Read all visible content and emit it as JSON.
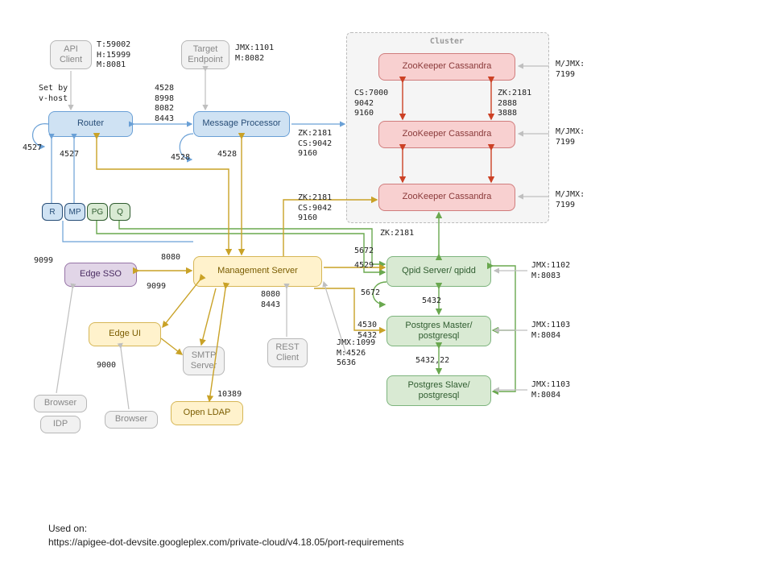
{
  "cluster_title": "Cluster",
  "nodes": {
    "api_client": "API\nClient",
    "target_ep": "Target\nEndpoint",
    "router": "Router",
    "msgproc": "Message Processor",
    "zk1": "ZooKeeper\nCassandra",
    "zk2": "ZooKeeper\nCassandra",
    "zk3": "ZooKeeper\nCassandra",
    "chip_r": "R",
    "chip_mp": "MP",
    "chip_pg": "PG",
    "chip_q": "Q",
    "edge_sso": "Edge SSO",
    "mgmt": "Management Server",
    "qpid": "Qpid Server/\nqpidd",
    "pg_master": "Postgres Master/\npostgresql",
    "pg_slave": "Postgres Slave/\npostgresql",
    "edge_ui": "Edge UI",
    "smtp": "SMTP\nServer",
    "rest": "REST\nClient",
    "browser1": "Browser",
    "idp": "IDP",
    "browser2": "Browser",
    "ldap": "Open LDAP"
  },
  "port_labels": {
    "api_client_ports": "T:59002\nH:15999\nM:8081",
    "target_ports": "JMX:1101\nM:8082",
    "vhost": "Set by\nv-host",
    "router_to_mp": "4528\n8998\n8082\n8443",
    "router_self": "4527",
    "router_below": "4527",
    "mp_self": "4528",
    "mp_below": "4528",
    "mp_to_zk": "ZK:2181\nCS:9042\n9160",
    "cluster_cs": "CS:7000\n9042\n9160",
    "cluster_zk": "ZK:2181\n2888\n3888",
    "zk_jmx": "M/JMX:\n7199",
    "mgmt_9099": "9099",
    "sso_9099": "9099",
    "mgmt_left_8080": "8080",
    "mgmt_right_ports": "8080\n8443",
    "mgmt_to_zk": "ZK:2181\nCS:9042\n9160",
    "zk_2181": "ZK:2181",
    "qpid_5672": "5672",
    "mgmt_4529": "4529",
    "qpid_self": "5672",
    "qpid_jmx": "JMX:1102\nM:8083",
    "qpid_to_pg": "5432",
    "mgmt_to_pg": "4530\n5432",
    "pg_master_jmx": "JMX:1103\nM:8084",
    "pg_repl": "5432,22",
    "pg_slave_jmx": "JMX:1103\nM:8084",
    "jmx_mgmt": "JMX:1099\nM:4526\n5636",
    "ui_9000": "9000",
    "ldap_10389": "10389"
  },
  "footer": {
    "used_on": "Used on:",
    "url": "https://apigee-dot-devsite.googleplex.com/private-cloud/v4.18.05/port-requirements"
  }
}
